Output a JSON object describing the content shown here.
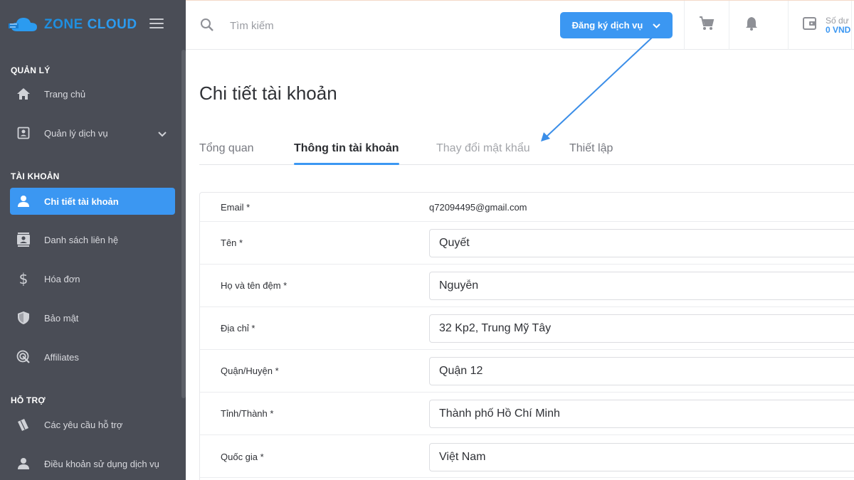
{
  "brand": {
    "part1": "ZONE",
    "part2": "CLOUD"
  },
  "sidebar": {
    "sections": [
      {
        "title": "QUẢN LÝ"
      },
      {
        "title": "TÀI KHOẢN"
      },
      {
        "title": "HỖ TRỢ"
      }
    ],
    "items": [
      {
        "label": "Trang chủ",
        "icon": "home-icon"
      },
      {
        "label": "Quản lý dịch vụ",
        "icon": "account-box-icon",
        "has_chevron": true
      },
      {
        "label": "Chi tiết tài khoản",
        "icon": "user-icon",
        "active": true
      },
      {
        "label": "Danh sách liên hệ",
        "icon": "contacts-icon"
      },
      {
        "label": "Hóa đơn",
        "icon": "dollar-icon"
      },
      {
        "label": "Bảo mật",
        "icon": "shield-icon"
      },
      {
        "label": "Affiliates",
        "icon": "target-icon"
      },
      {
        "label": "Các yêu cầu hỗ trợ",
        "icon": "ticket-icon"
      },
      {
        "label": "Điều khoản sử dụng dịch vụ",
        "icon": "user-icon"
      }
    ]
  },
  "header": {
    "search_placeholder": "Tìm kiếm",
    "register_button": "Đăng ký dịch vụ",
    "balance_label": "Số dư",
    "balance_value": "0 VND"
  },
  "main": {
    "title": "Chi tiết tài khoản",
    "tabs": [
      {
        "label": "Tổng quan"
      },
      {
        "label": "Thông tin tài khoản",
        "active": true
      },
      {
        "label": "Thay đổi mật khẩu"
      },
      {
        "label": "Thiết lập"
      }
    ],
    "form": {
      "email_label": "Email *",
      "email_value": "q72094495@gmail.com",
      "fields": [
        {
          "label": "Tên *",
          "value": "Quyết"
        },
        {
          "label": "Họ và tên đệm *",
          "value": "Nguyễn"
        },
        {
          "label": "Địa chỉ *",
          "value": "32 Kp2, Trung Mỹ Tây"
        },
        {
          "label": "Quận/Huyện *",
          "value": "Quận 12"
        },
        {
          "label": "Tỉnh/Thành *",
          "value": "Thành phố Hồ Chí Minh"
        },
        {
          "label": "Quốc gia *",
          "value": "Việt Nam"
        }
      ]
    }
  },
  "colors": {
    "accent": "#3b97f2",
    "sidebar_bg": "#4a4d56"
  }
}
